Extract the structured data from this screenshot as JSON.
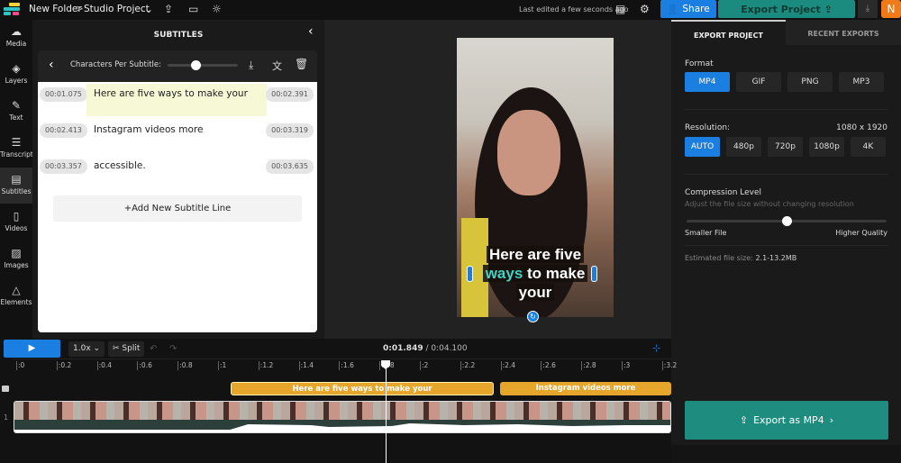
{
  "topbar": {
    "folder": "New Folder",
    "separator": ">",
    "project": "Studio Project",
    "last_edited": "Last edited a few seconds ago",
    "share": "Share",
    "export_project": "Export Project",
    "avatar": "N"
  },
  "nav": [
    {
      "label": "Media",
      "icon": "cloud-upload-icon"
    },
    {
      "label": "Layers",
      "icon": "layers-icon"
    },
    {
      "label": "Text",
      "icon": "edit-icon"
    },
    {
      "label": "Transcript",
      "icon": "transcript-icon"
    },
    {
      "label": "Subtitles",
      "icon": "subtitles-icon",
      "active": true
    },
    {
      "label": "Videos",
      "icon": "film-icon"
    },
    {
      "label": "Images",
      "icon": "image-icon"
    },
    {
      "label": "Elements",
      "icon": "shapes-icon"
    }
  ],
  "subtitles": {
    "title": "SUBTITLES",
    "chars_label": "Characters Per Subtitle:",
    "chars_level": 0.4,
    "add_line": "+Add New Subtitle Line",
    "lines": [
      {
        "start": "00:01.075",
        "end": "00:02.391",
        "text": "Here are five ways to make your"
      },
      {
        "start": "00:02.413",
        "end": "00:03.319",
        "text": "Instagram videos more"
      },
      {
        "start": "00:03.357",
        "end": "00:03.635",
        "text": "accessible."
      }
    ]
  },
  "preview": {
    "caption_line1": "Here are five",
    "caption_hl": "ways",
    "caption_rest": " to make",
    "caption_line3": "your",
    "highlight_color": "#3fd4c6"
  },
  "export": {
    "tabs": [
      "EXPORT PROJECT",
      "RECENT EXPORTS"
    ],
    "format_label": "Format",
    "formats": [
      "MP4",
      "GIF",
      "PNG",
      "MP3"
    ],
    "format_selected": "MP4",
    "resolution_label": "Resolution:",
    "resolution_value": "1080 x 1920",
    "resolutions": [
      "AUTO",
      "480p",
      "720p",
      "1080p",
      "4K"
    ],
    "resolution_selected": "AUTO",
    "compression_label": "Compression Level",
    "compression_desc": "Adjust the file size without changing resolution",
    "compression_level": 0.5,
    "smaller": "Smaller File",
    "higher": "Higher Quality",
    "est_label": "Estimated file size:",
    "est_value": "2.1-13.2MB",
    "export_button": "Export as MP4"
  },
  "timeline": {
    "speed": "1.0x",
    "split": "Split",
    "current": "0:01.849",
    "total": "/ 0:04.100",
    "ticks": [
      ":0",
      ":0.2",
      ":0.4",
      ":0.6",
      ":0.8",
      ":1",
      ":1.2",
      ":1.4",
      ":1.6",
      ":1.8",
      ":2",
      ":2.2",
      ":2.4",
      ":2.6",
      ":2.8",
      ":3",
      ":3.2"
    ],
    "clips": [
      "Here are five ways to make your",
      "Instagram videos more"
    ],
    "track_number": "1"
  },
  "colors": {
    "accent": "#1a7fe0",
    "export": "#1e8d80",
    "clip": "#e5a62b",
    "avatar": "#ee7a1a"
  }
}
